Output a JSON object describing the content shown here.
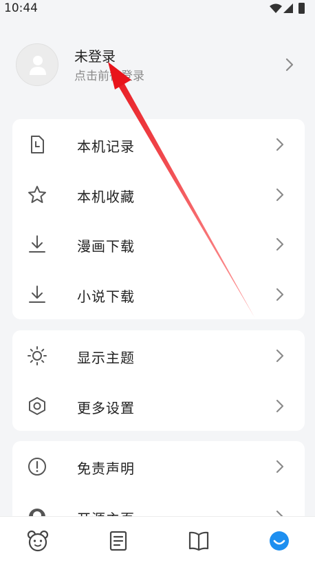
{
  "status_bar": {
    "time": "10:44"
  },
  "profile": {
    "name": "未登录",
    "subtitle": "点击前往登录"
  },
  "menu_groups": [
    {
      "items": [
        {
          "label": "本机记录",
          "icon": "history-doc-icon"
        },
        {
          "label": "本机收藏",
          "icon": "star-icon"
        },
        {
          "label": "漫画下载",
          "icon": "download-icon"
        },
        {
          "label": "小说下载",
          "icon": "download-icon"
        }
      ]
    },
    {
      "items": [
        {
          "label": "显示主题",
          "icon": "sun-icon"
        },
        {
          "label": "更多设置",
          "icon": "hexagon-settings-icon"
        }
      ]
    },
    {
      "items": [
        {
          "label": "免责声明",
          "icon": "alert-circle-icon"
        },
        {
          "label": "开源主页",
          "icon": "github-icon"
        }
      ]
    }
  ],
  "tab_bar": {
    "tabs": [
      {
        "icon": "bear-face-icon",
        "active": false
      },
      {
        "icon": "news-icon",
        "active": false
      },
      {
        "icon": "book-icon",
        "active": false
      },
      {
        "icon": "smile-face-icon",
        "active": true
      }
    ],
    "accent_color": "#1e8ff0"
  },
  "annotation": {
    "color": "#e8141b"
  }
}
